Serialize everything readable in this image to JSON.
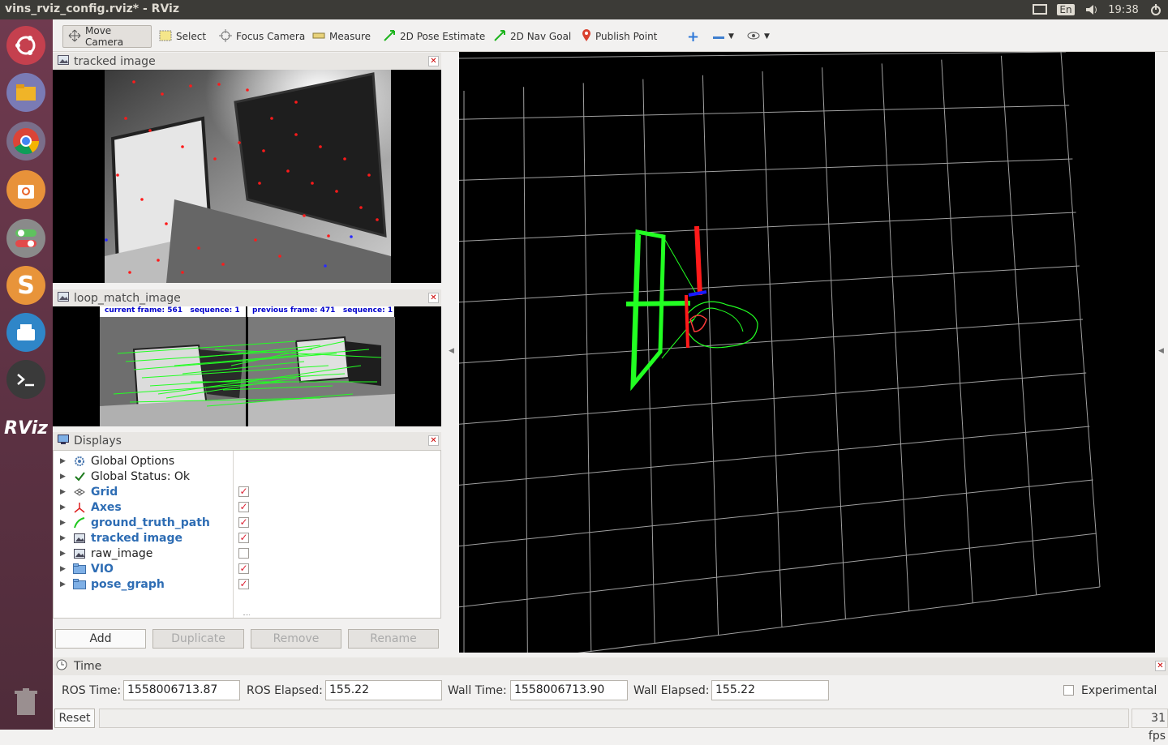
{
  "window": {
    "title": "vins_rviz_config.rviz* - RViz"
  },
  "tray": {
    "language": "En",
    "time": "19:38"
  },
  "launcher": {
    "items": [
      "ubuntu-dash",
      "files",
      "chrome",
      "software-center",
      "system-settings",
      "sublime-text",
      "storage",
      "terminal",
      "rviz",
      "trash"
    ],
    "rviz_label": "RViz"
  },
  "toolbar": {
    "move_camera": "Move Camera",
    "select": "Select",
    "focus_camera": "Focus Camera",
    "measure": "Measure",
    "pose_estimate": "2D Pose Estimate",
    "nav_goal": "2D Nav Goal",
    "publish_point": "Publish Point"
  },
  "panels": {
    "tracked_image": {
      "title": "tracked image"
    },
    "loop_match": {
      "title": "loop_match_image",
      "current_label": "current frame: 561   sequence: 1",
      "previous_label": "previous frame: 471   sequence: 1"
    },
    "displays": {
      "title": "Displays"
    }
  },
  "displays": [
    {
      "name": "Global Options",
      "icon": "gear-icon",
      "checked": null,
      "enabled": false
    },
    {
      "name": "Global Status: Ok",
      "icon": "check-icon",
      "checked": null,
      "enabled": false
    },
    {
      "name": "Grid",
      "icon": "grid-icon",
      "checked": true,
      "enabled": true
    },
    {
      "name": "Axes",
      "icon": "axes-icon",
      "checked": true,
      "enabled": true
    },
    {
      "name": "ground_truth_path",
      "icon": "path-icon",
      "checked": true,
      "enabled": true
    },
    {
      "name": "tracked image",
      "icon": "image-icon",
      "checked": true,
      "enabled": true
    },
    {
      "name": "raw_image",
      "icon": "image-icon",
      "checked": false,
      "enabled": false
    },
    {
      "name": "VIO",
      "icon": "folder-icon",
      "checked": true,
      "enabled": true
    },
    {
      "name": "pose_graph",
      "icon": "folder-icon",
      "checked": true,
      "enabled": true
    }
  ],
  "display_buttons": {
    "add": "Add",
    "duplicate": "Duplicate",
    "remove": "Remove",
    "rename": "Rename"
  },
  "time": {
    "title": "Time",
    "ros_time_label": "ROS Time:",
    "ros_time": "1558006713.87",
    "ros_elapsed_label": "ROS Elapsed:",
    "ros_elapsed": "155.22",
    "wall_time_label": "Wall Time:",
    "wall_time": "1558006713.90",
    "wall_elapsed_label": "Wall Elapsed:",
    "wall_elapsed": "155.22",
    "experimental_label": "Experimental"
  },
  "status": {
    "reset": "Reset",
    "fps": "31 fps"
  },
  "colors": {
    "grid": "#a0a0a0",
    "path": "#22ff22",
    "axis_x": "#ff1a1a",
    "axis_z": "#0000ff"
  }
}
